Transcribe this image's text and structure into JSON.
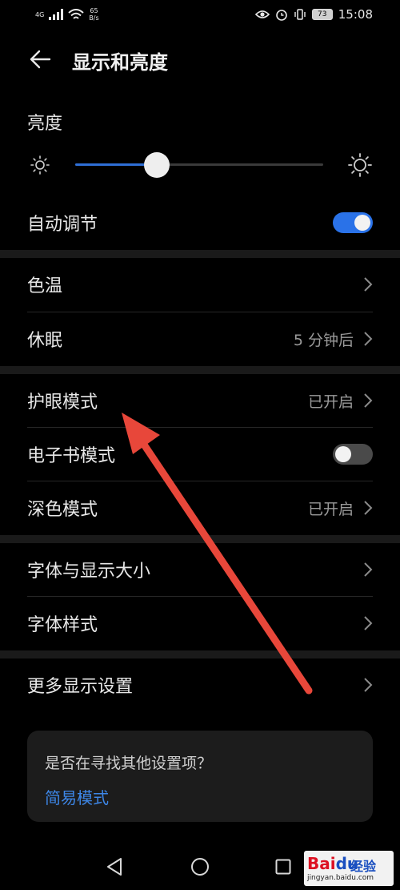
{
  "statusbar": {
    "network": "4G",
    "speed_value": "65",
    "speed_unit": "B/s",
    "battery": "73",
    "time": "15:08"
  },
  "header": {
    "title": "显示和亮度"
  },
  "brightness": {
    "label": "亮度",
    "level_percent": 33
  },
  "auto_adjust": {
    "label": "自动调节",
    "on": true
  },
  "group1": {
    "color_temp": "色温",
    "sleep_label": "休眠",
    "sleep_value": "5 分钟后"
  },
  "group2": {
    "eye_comfort_label": "护眼模式",
    "eye_comfort_value": "已开启",
    "ebook_label": "电子书模式",
    "ebook_on": false,
    "dark_label": "深色模式",
    "dark_value": "已开启"
  },
  "group3": {
    "font_size_label": "字体与显示大小",
    "font_style_label": "字体样式"
  },
  "group4": {
    "more_label": "更多显示设置"
  },
  "suggest_card": {
    "question": "是否在寻找其他设置项？",
    "link": "简易模式"
  },
  "watermark": {
    "logo_left": "Bai",
    "logo_right": "du",
    "brand": "经验",
    "url": "jingyan.baidu.com"
  },
  "colors": {
    "accent": "#2a72e8",
    "link": "#3d86e6",
    "annotation_arrow": "#e8473a"
  }
}
